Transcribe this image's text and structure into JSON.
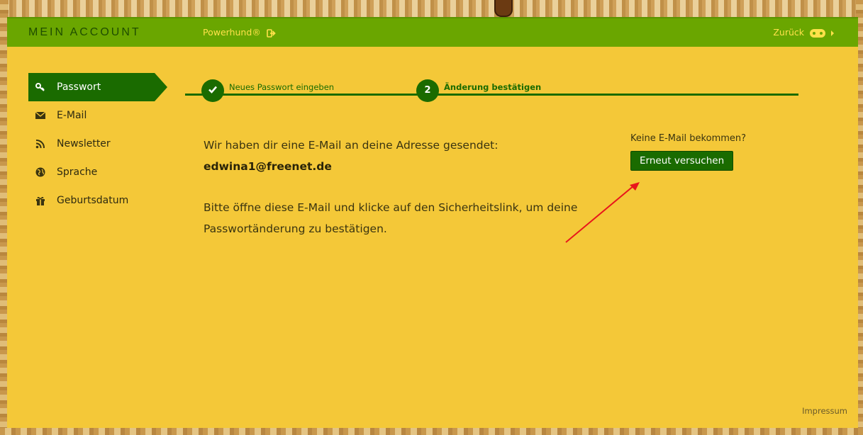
{
  "header": {
    "title": "MEIN ACCOUNT",
    "brand_link": "Powerhund®",
    "back_link": "Zurück"
  },
  "sidebar": {
    "items": [
      {
        "label": "Passwort",
        "icon": "key-icon",
        "active": true
      },
      {
        "label": "E-Mail",
        "icon": "envelope-icon",
        "active": false
      },
      {
        "label": "Newsletter",
        "icon": "rss-icon",
        "active": false
      },
      {
        "label": "Sprache",
        "icon": "globe-icon",
        "active": false
      },
      {
        "label": "Geburtsdatum",
        "icon": "gift-icon",
        "active": false
      }
    ]
  },
  "stepper": {
    "steps": [
      {
        "label": "Neues Passwort eingeben",
        "marker": "check-icon",
        "done": true
      },
      {
        "label": "Änderung bestätigen",
        "marker": "2",
        "done": false
      }
    ]
  },
  "main": {
    "sent_text": "Wir haben dir eine E-Mail an deine Adresse gesendet:",
    "email": "edwina1@freenet.de",
    "instruction": "Bitte öffne diese E-Mail und klicke auf den Sicherheitslink, um deine Passwortänderung zu bestätigen."
  },
  "retry": {
    "question": "Keine E-Mail bekommen?",
    "button_label": "Erneut versuchen"
  },
  "footer": {
    "impressum": "Impressum"
  },
  "colors": {
    "panel": "#f4c838",
    "topbar": "#6aa600",
    "accent_dark_green": "#1a6b00",
    "link_yellow": "#ffe14a",
    "annotation_arrow": "#e8161b"
  }
}
